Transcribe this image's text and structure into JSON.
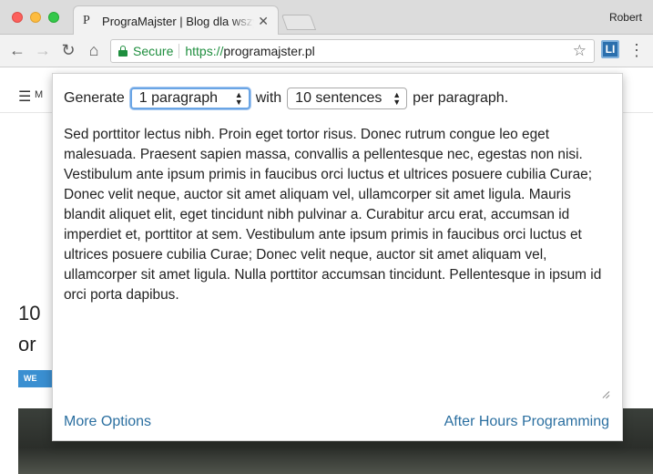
{
  "browser": {
    "tab_title": "PrograMajster | Blog dla wszystkich",
    "tab_favicon": "P",
    "profile_name": "Robert",
    "security_label": "Secure",
    "url_scheme": "https://",
    "url_host": "programajster.pl",
    "extension_badge": "LI"
  },
  "page": {
    "menu_letter": "M",
    "heading_fragment_1": "10",
    "heading_fragment_2": "or",
    "badge": "WE"
  },
  "popup": {
    "generate_label": "Generate",
    "paragraphs_select": "1 paragraph",
    "with_label": "with",
    "sentences_select": "10 sentences",
    "per_label": "per paragraph.",
    "generated_text": "Sed porttitor lectus nibh. Proin eget tortor risus. Donec rutrum congue leo eget malesuada. Praesent sapien massa, convallis a pellentesque nec, egestas non nisi. Vestibulum ante ipsum primis in faucibus orci luctus et ultrices posuere cubilia Curae; Donec velit neque, auctor sit amet aliquam vel, ullamcorper sit amet ligula. Mauris blandit aliquet elit, eget tincidunt nibh pulvinar a. Curabitur arcu erat, accumsan id imperdiet et, porttitor at sem. Vestibulum ante ipsum primis in faucibus orci luctus et ultrices posuere cubilia Curae; Donec velit neque, auctor sit amet aliquam vel, ullamcorper sit amet ligula. Nulla porttitor accumsan tincidunt. Pellentesque in ipsum id orci porta dapibus.",
    "more_options": "More Options",
    "after_hours": "After Hours Programming"
  },
  "colors": {
    "link": "#2b6fa0",
    "secure_green": "#1e8e3e",
    "extension_blue": "#2b6fad"
  }
}
